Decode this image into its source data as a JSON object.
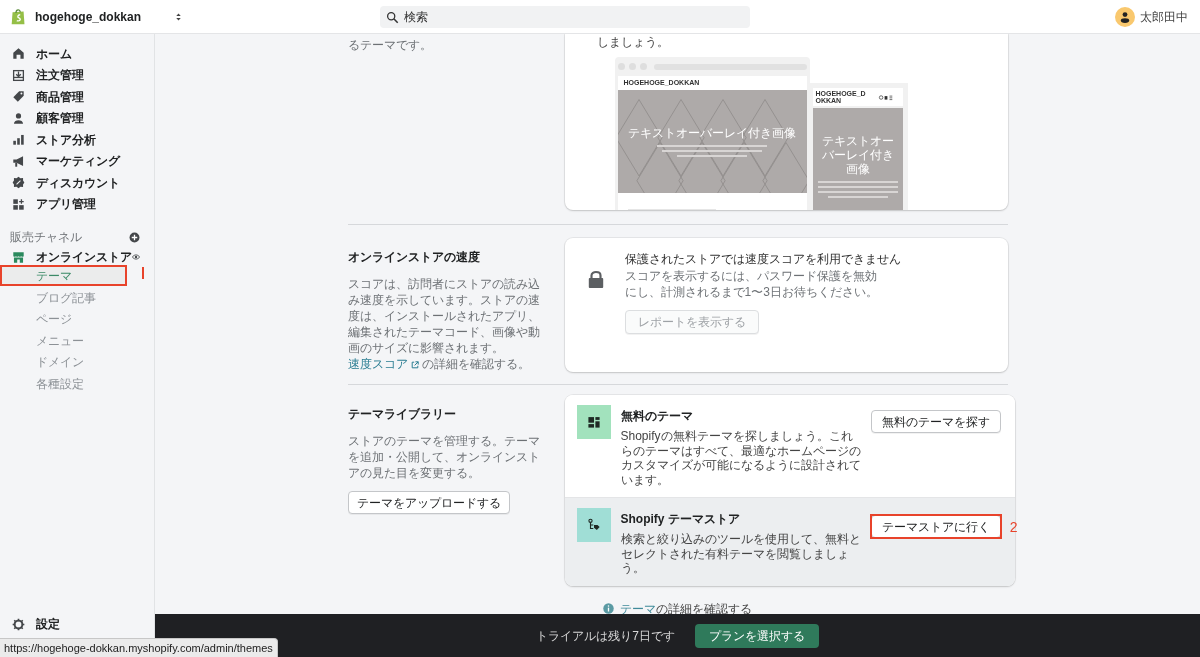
{
  "topbar": {
    "store_name": "hogehoge_dokkan",
    "search": {
      "placeholder": "検索"
    },
    "user": {
      "name": "太郎田中"
    }
  },
  "sidebar": {
    "items": [
      {
        "label": "ホーム"
      },
      {
        "label": "注文管理"
      },
      {
        "label": "商品管理"
      },
      {
        "label": "顧客管理"
      },
      {
        "label": "ストア分析"
      },
      {
        "label": "マーケティング"
      },
      {
        "label": "ディスカウント"
      },
      {
        "label": "アプリ管理"
      }
    ],
    "channels_heading": "販売チャネル",
    "channel": {
      "label": "オンラインストア",
      "sub_items": [
        {
          "label": "テーマ",
          "selected": true,
          "highlighted": true
        },
        {
          "label": "ブログ記事",
          "selected": false,
          "highlighted": false
        },
        {
          "label": "ページ",
          "selected": false,
          "highlighted": false
        },
        {
          "label": "メニュー",
          "selected": false,
          "highlighted": false
        },
        {
          "label": "ドメイン",
          "selected": false,
          "highlighted": false
        },
        {
          "label": "各種設定",
          "selected": false,
          "highlighted": false
        }
      ]
    },
    "settings": "設定"
  },
  "theme_section": {
    "description": "るテーマです。",
    "card_text": "しましょう。",
    "preview": {
      "desktop_logo": "HOGEHOGE_DOKKAN",
      "desktop_heading": "テキストオーバーレイ付き画像",
      "mobile_logo": "HOGEHOGE_DOKKAN",
      "mobile_heading": "テキストオーバーレイ付き画像"
    }
  },
  "speed_section": {
    "title": "オンラインストアの速度",
    "description": "スコアは、訪問者にストアの読み込み速度を示しています。ストアの速度は、インストールされたアプリ、編集されたテーマコード、画像や動画のサイズに影響されます。",
    "link": "速度スコア",
    "description_end": "の詳細を確認する。",
    "notice_title": "保護されたストアでは速度スコアを利用できません",
    "notice_text": "スコアを表示するには、パスワード保護を無効にし、計測されるまで1〜3日お待ちください。",
    "button": {
      "label": "レポートを表示する",
      "disabled": true
    }
  },
  "library_section": {
    "title": "テーマライブラリー",
    "description": "ストアのテーマを管理する。テーマを追加・公開して、オンラインストアの見た目を変更する。",
    "upload_button": "テーマをアップロードする",
    "items": [
      {
        "title": "無料のテーマ",
        "description": "Shopifyの無料テーマを探しましょう。これらのテーマはすべて、最適なホームページのカスタマイズが可能になるように設計されています。",
        "button": "無料のテーマを探す",
        "color": "#a2e2bd",
        "hovered": false,
        "highlighted": false
      },
      {
        "title": "Shopify テーマストア",
        "description": "検索と絞り込みのツールを使用して、無料とセレクトされた有料テーマを閲覧しましょう。",
        "button": "テーマストアに行く",
        "color": "#a0ded6",
        "hovered": true,
        "highlighted": true,
        "annotation": "2"
      }
    ]
  },
  "help": {
    "link": "テーマ",
    "text": "の詳細を確認する"
  },
  "trial_bar": {
    "text": "トライアルは残り7日です",
    "button": "プランを選択する"
  },
  "status_url": "https://hogehoge-dokkan.myshopify.com/admin/themes"
}
